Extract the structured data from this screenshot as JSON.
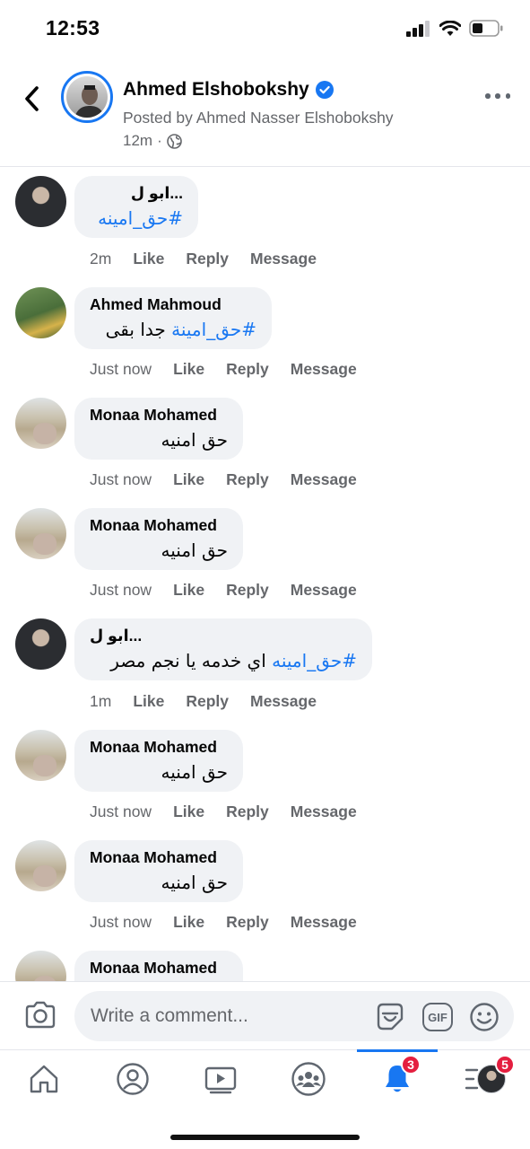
{
  "status_bar": {
    "time": "12:53",
    "icons": [
      "cellular-signal-icon",
      "wifi-icon",
      "battery-icon"
    ]
  },
  "header": {
    "name": "Ahmed Elshobokshy",
    "verified": true,
    "posted_by": "Posted by Ahmed Nasser Elshobokshy",
    "time": "12m",
    "separator": "·",
    "audience_icon": "globe-icon"
  },
  "actions_labels": {
    "like": "Like",
    "reply": "Reply",
    "message": "Message"
  },
  "comments": [
    {
      "author": "ابو ل...",
      "text_hashtag": "#حق_امينه",
      "text_plain": "",
      "time": "2m",
      "avatar": "dark-portrait"
    },
    {
      "author": "Ahmed Mahmoud",
      "text_hashtag": "#حق_امينة",
      "text_plain": "جدا بقى",
      "time": "Just now",
      "avatar": "football-field"
    },
    {
      "author": "Monaa Mohamed",
      "text_hashtag": "",
      "text_plain": "حق امنيه",
      "time": "Just now",
      "avatar": "beach"
    },
    {
      "author": "Monaa Mohamed",
      "text_hashtag": "",
      "text_plain": "حق امنيه",
      "time": "Just now",
      "avatar": "beach"
    },
    {
      "author": "ابو ل...",
      "text_hashtag": "#حق_امينه",
      "text_plain": "اي خدمه يا نجم مصر",
      "time": "1m",
      "avatar": "dark-portrait"
    },
    {
      "author": "Monaa Mohamed",
      "text_hashtag": "",
      "text_plain": "حق امنيه",
      "time": "Just now",
      "avatar": "beach"
    },
    {
      "author": "Monaa Mohamed",
      "text_hashtag": "",
      "text_plain": "حق امنيه",
      "time": "Just now",
      "avatar": "beach"
    },
    {
      "author": "Monaa Mohamed",
      "text_hashtag": "",
      "text_plain": "",
      "time": "",
      "avatar": "beach"
    }
  ],
  "composer": {
    "placeholder": "Write a comment...",
    "gif_label": "GIF"
  },
  "bottom_nav": {
    "items": [
      "home-icon",
      "profile-icon",
      "video-icon",
      "groups-icon",
      "notifications-icon",
      "menu-icon"
    ],
    "notifications_badge": "3",
    "menu_badge": "5",
    "active": "notifications-icon"
  },
  "colors": {
    "accent": "#1877f2",
    "secondary_text": "#65676b",
    "bubble": "#f0f2f5",
    "badge": "#e41e3f"
  }
}
